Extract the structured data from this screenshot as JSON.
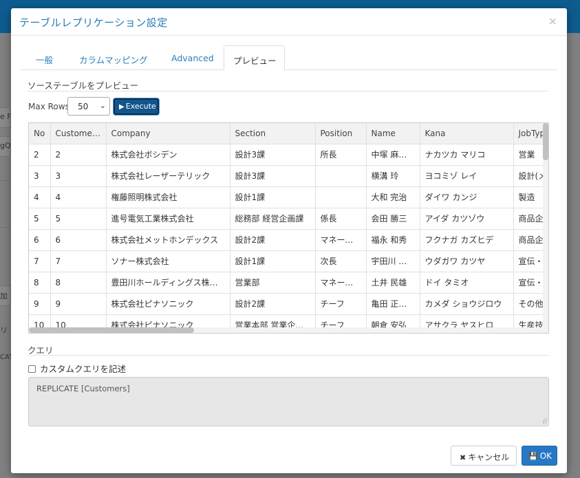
{
  "dialog": {
    "title": "テーブルレプリケーション設定",
    "close_glyph": "×"
  },
  "tabs": [
    {
      "label": "一般",
      "active": false
    },
    {
      "label": "カラムマッピング",
      "active": false
    },
    {
      "label": "Advanced",
      "active": false
    },
    {
      "label": "プレビュー",
      "active": true
    }
  ],
  "preview": {
    "section_title": "ソーステーブルをプレビュー",
    "max_rows_label": "Max Rows:",
    "max_rows_value": "50",
    "execute_label": "Execute",
    "columns": [
      "No",
      "CustomerNo",
      "Company",
      "Section",
      "Position",
      "Name",
      "Kana",
      "JobTyp"
    ],
    "rows": [
      [
        "2",
        "2",
        "株式会社ボシデン",
        "設計3課",
        "所長",
        "中塚 麻里子",
        "ナカツカ マリコ",
        "営業"
      ],
      [
        "3",
        "3",
        "株式会社レーザーテリック",
        "設計3課",
        "",
        "横溝 玲",
        "ヨコミゾ レイ",
        "設計(メ"
      ],
      [
        "4",
        "4",
        "権藤照明株式会社",
        "設計1課",
        "",
        "大和 完治",
        "ダイワ カンジ",
        "製造"
      ],
      [
        "5",
        "5",
        "進号電気工業株式会社",
        "総務部 経営企画課",
        "係長",
        "会田 勝三",
        "アイダ カツゾウ",
        "商品企"
      ],
      [
        "6",
        "6",
        "株式会社メットホンデックス",
        "設計2課",
        "マネージャ",
        "福永 和秀",
        "フクナガ カズヒデ",
        "商品企"
      ],
      [
        "7",
        "7",
        "ソナー株式会社",
        "設計1課",
        "次長",
        "宇田川 勝哉",
        "ウダガワ カツヤ",
        "宣伝・"
      ],
      [
        "8",
        "8",
        "豊田川ホールディングス株式会社",
        "営業部",
        "マネージャ",
        "土井 民雄",
        "ドイ タミオ",
        "宣伝・"
      ],
      [
        "9",
        "9",
        "株式会社ピナソニック",
        "設計2課",
        "チーフ",
        "亀田 正次郎",
        "カメダ ショウジロウ",
        "その他"
      ],
      [
        "10",
        "10",
        "株式会社ピナソニック",
        "営業本部 営業企画課",
        "チーフ",
        "朝倉 安弘",
        "アサクラ ヤスヒロ",
        "生産技"
      ]
    ]
  },
  "query": {
    "section_title": "クエリ",
    "custom_query_label": "カスタムクエリを記述",
    "custom_query_checked": false,
    "text": "REPLICATE [Customers]"
  },
  "footer": {
    "cancel_label": "キャンセル",
    "ok_label": "OK"
  },
  "background": {
    "fragments": [
      "e F",
      "gQ",
      "加",
      "リ",
      "CAT"
    ]
  },
  "colors": {
    "accent": "#2778c4",
    "execute_bg": "#13568c",
    "title": "#1f7bb5"
  }
}
